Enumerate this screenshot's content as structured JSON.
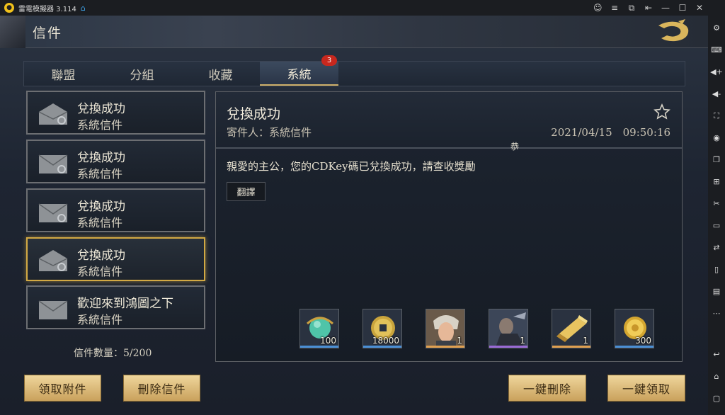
{
  "emulator": {
    "title": "雷電模擬器 3.114",
    "logo_icon": "leidian-logo-icon",
    "sidebar_icons": [
      "settings-icon",
      "keyboard-icon",
      "volume-up-icon",
      "volume-down-icon",
      "fullscreen-icon",
      "record-icon",
      "multi-instance-icon",
      "apk-install-icon",
      "scissors-icon",
      "video-icon",
      "sync-icon",
      "rotate-icon",
      "screenshot-icon",
      "more-icon"
    ],
    "nav_icons": [
      "back-icon",
      "home-icon",
      "recent-apps-icon"
    ]
  },
  "header": {
    "title": "信件"
  },
  "tabs": [
    {
      "label": "聯盟"
    },
    {
      "label": "分組"
    },
    {
      "label": "收藏"
    },
    {
      "label": "系統",
      "badge": "3"
    }
  ],
  "mails": [
    {
      "subject": "兌換成功",
      "sender": "系統信件",
      "state": "read"
    },
    {
      "subject": "兌換成功",
      "sender": "系統信件",
      "state": "unread"
    },
    {
      "subject": "兌換成功",
      "sender": "系統信件",
      "state": "unread"
    },
    {
      "subject": "兌換成功",
      "sender": "系統信件",
      "state": "read"
    },
    {
      "subject": "歡迎來到鴻圖之下",
      "sender": "系統信件",
      "state": "unread"
    }
  ],
  "mail_count": "信件數量：5/200",
  "detail": {
    "title": "兌換成功",
    "sender": "寄件人：系統信件",
    "date": "2021/04/15　09:50:16",
    "marquee": "恭",
    "body": "親愛的主公，您的CDKey碼已兌換成功，請查收獎勵",
    "translate_label": "翻譯"
  },
  "attachments": [
    {
      "name": "jade-orb-icon",
      "qty": "100",
      "rarity_color": "#4a8fd6"
    },
    {
      "name": "copper-coin-icon",
      "qty": "18000",
      "rarity_color": "#4a8fd6"
    },
    {
      "name": "hero-portrait-icon",
      "qty": "1",
      "rarity_color": "#e0a050"
    },
    {
      "name": "warrior-portrait-icon",
      "qty": "1",
      "rarity_color": "#9a6ad6"
    },
    {
      "name": "scroll-icon",
      "qty": "1",
      "rarity_color": "#e0a050"
    },
    {
      "name": "gold-coin-icon",
      "qty": "300",
      "rarity_color": "#4a8fd6"
    }
  ],
  "buttons": {
    "claim_attachments": "領取附件",
    "delete_mail": "刪除信件",
    "delete_all": "一鍵刪除",
    "claim_all": "一鍵領取"
  }
}
